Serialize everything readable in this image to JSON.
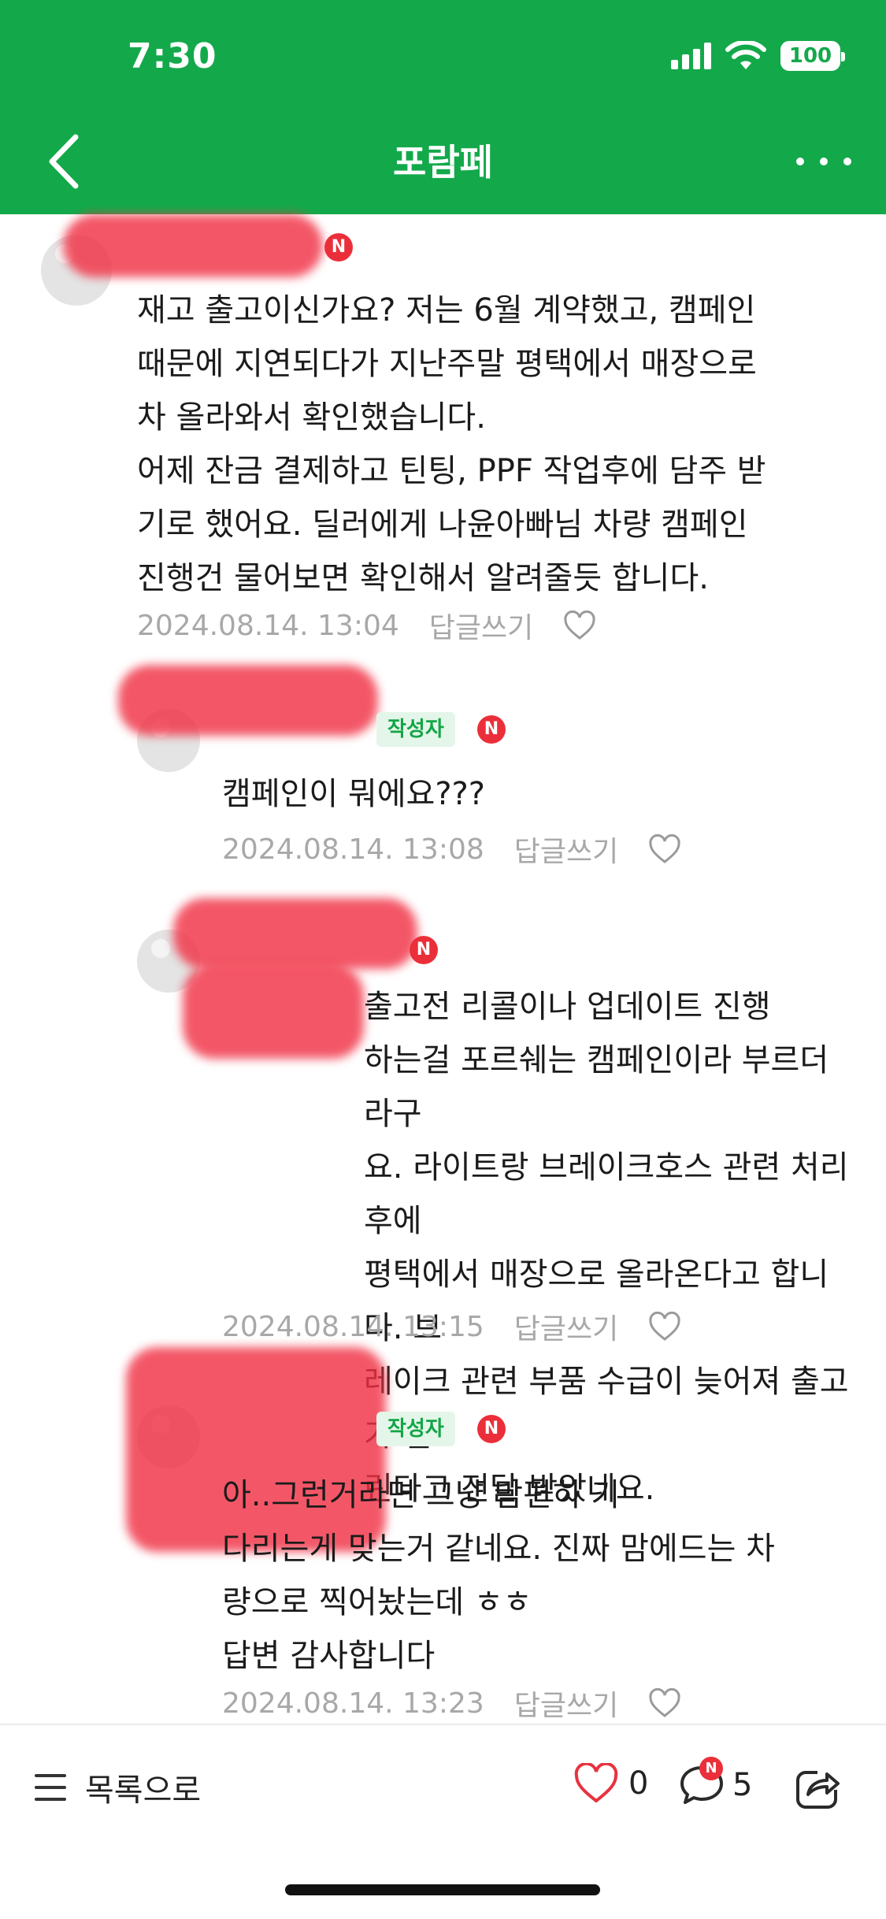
{
  "status_bar": {
    "time": "7:30",
    "battery": "100"
  },
  "header": {
    "title": "포람페"
  },
  "colors": {
    "brand_green": "#13a94b",
    "new_badge_red": "#eb2f3a",
    "writer_badge_text": "#12a546",
    "meta_gray": "#a8a8a8"
  },
  "comments": [
    {
      "lines": "재고 출고이신가요? 저는 6월 계약했고, 캠페인\n때문에 지연되다가 지난주말 평택에서 매장으로\n차 올라와서 확인했습니다.\n어제 잔금 결제하고 틴팅, PPF 작업후에 담주 받\n기로 했어요. 딜러에게 나윤아빠님 차량 캠페인\n진행건 물어보면 확인해서 알려줄듯 합니다.",
      "date": "2024.08.14. 13:04",
      "reply": "답글쓰기",
      "new_badge": "N"
    },
    {
      "writer_badge": "작성자",
      "lines": "캠페인이 뭐에요???",
      "date": "2024.08.14. 13:08",
      "reply": "답글쓰기",
      "new_badge": "N"
    },
    {
      "lines": "출고전 리콜이나 업데이트 진행\n하는걸 포르쉐는 캠페인이라 부르더라구\n요. 라이트랑 브레이크호스 관련 처리후에\n평택에서 매장으로 올라온다고 합니다. 브\n레이크 관련 부품 수급이 늦어져 출고가 밀\n린다고 전달 받았네요.",
      "date": "2024.08.14. 13:15",
      "reply": "답글쓰기",
      "new_badge": "N"
    },
    {
      "writer_badge": "작성자",
      "lines": "아..그런거라면 그냥 맘편히 기\n다리는게 맞는거 같네요. 진짜 맘에드는 차\n량으로 찍어놨는데 ㅎㅎ\n답변 감사합니다",
      "date": "2024.08.14. 13:23",
      "reply": "답글쓰기",
      "new_badge": "N"
    }
  ],
  "bottom_bar": {
    "list_label": "목록으로",
    "like_count": "0",
    "comment_count": "5",
    "comment_new_badge": "N",
    "icons": [
      "menu-icon",
      "heart-icon",
      "comment-icon",
      "share-icon"
    ]
  }
}
